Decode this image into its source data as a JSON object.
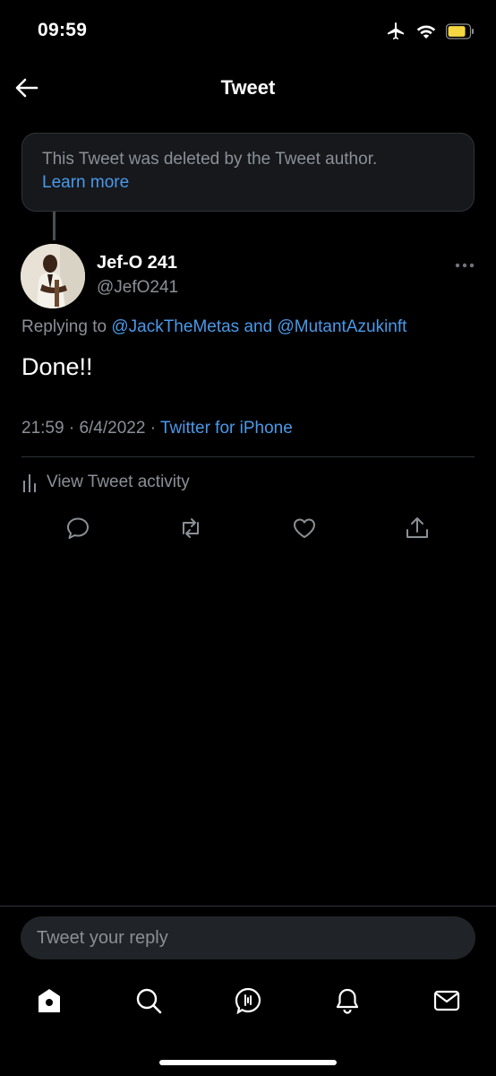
{
  "status_bar": {
    "time": "09:59",
    "icons": [
      "airplane-icon",
      "wifi-icon",
      "battery-icon"
    ],
    "battery_color": "#f5d742"
  },
  "header": {
    "back_icon": "arrow-left-icon",
    "title": "Tweet"
  },
  "deleted_notice": {
    "text": "This Tweet was deleted by the Tweet author.",
    "link": "Learn more"
  },
  "tweet": {
    "author": {
      "display_name": "Jef-O 241",
      "handle": "@JefO241"
    },
    "replying_prefix": "Replying to",
    "mention_1": "@JackTheMetas",
    "conjunction": "and",
    "mention_2": "@MutantAzukinft",
    "text": "Done!!",
    "time": "21:59",
    "sep_1": "·",
    "date": "6/4/2022",
    "sep_2": "·",
    "source": "Twitter for iPhone",
    "activity_label": "View Tweet activity",
    "actions": [
      "reply-icon",
      "retweet-icon",
      "like-icon",
      "share-icon"
    ]
  },
  "reply_bar": {
    "placeholder": "Tweet your reply"
  },
  "bottom_nav": [
    "home-icon",
    "search-icon",
    "spaces-icon",
    "notifications-icon",
    "messages-icon"
  ],
  "colors": {
    "accent": "#4a99e9",
    "background": "#000000",
    "muted_text": "#8b9096"
  }
}
